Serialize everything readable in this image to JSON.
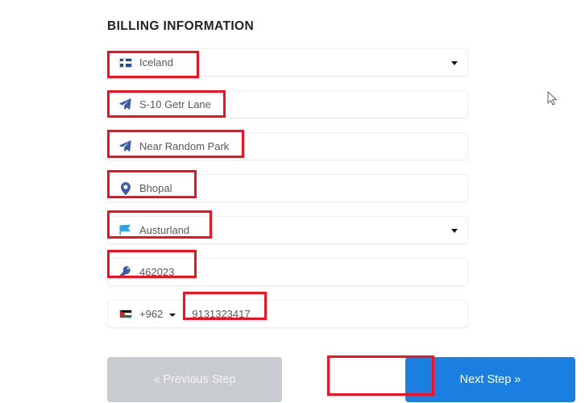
{
  "section": {
    "title": "BILLING INFORMATION"
  },
  "fields": {
    "country": {
      "value": "Iceland",
      "icon": "iceland-flag-icon",
      "type": "select"
    },
    "address_line1": {
      "value": "S-10 Getr Lane",
      "icon": "paper-plane-icon",
      "type": "text"
    },
    "address_line2": {
      "value": "Near Random Park",
      "icon": "paper-plane-icon",
      "type": "text"
    },
    "city": {
      "value": "Bhopal",
      "icon": "map-pin-icon",
      "type": "text"
    },
    "state": {
      "value": "Austurland",
      "icon": "flag-icon",
      "type": "select"
    },
    "zip": {
      "value": "462023",
      "icon": "key-icon",
      "type": "text"
    },
    "phone": {
      "country_code": "+962",
      "flag": "jordan-flag-icon",
      "number": "9131323417",
      "type": "tel"
    }
  },
  "buttons": {
    "previous": "« Previous Step",
    "next": "Next Step »"
  },
  "colors": {
    "primary": "#1a7fe0",
    "disabled": "#c8ccd0",
    "annotation": "#fc0d1b",
    "icon_blue": "#3b5ca8",
    "flag_blue": "#33a5e6",
    "text": "#55585c",
    "border": "#eceef0"
  }
}
